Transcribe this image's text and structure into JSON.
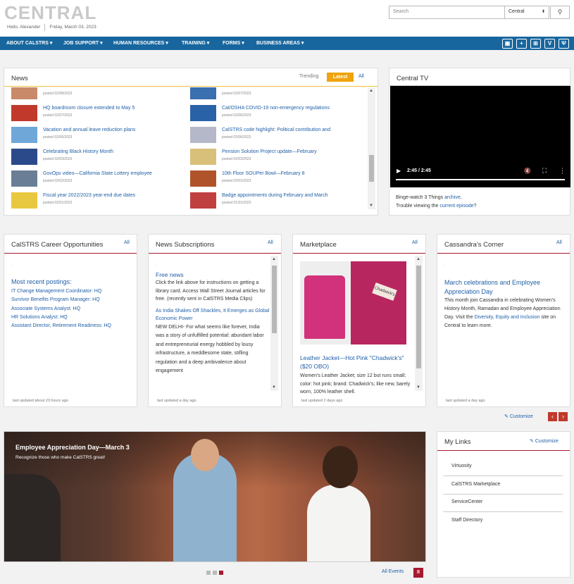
{
  "header": {
    "logo": "CENTRAL",
    "greeting": "Hello, Alexander",
    "date": "Friday, March 03, 2023",
    "search_placeholder": "Search",
    "scope": "Central",
    "search_icon": "search-icon"
  },
  "nav": {
    "items": [
      "ABOUT CALSTRS",
      "JOB SUPPORT",
      "HUMAN RESOURCES",
      "TRAINING",
      "FORMS",
      "BUSINESS AREAS"
    ],
    "icons": [
      "screen-icon",
      "plus-box-icon",
      "org-chart-icon",
      "v-icon",
      "utensils-icon"
    ]
  },
  "news": {
    "title": "News",
    "tabs": {
      "trending": "Trending",
      "latest": "Latest",
      "all": "All"
    },
    "left": [
      {
        "title": "",
        "date": "posted 02/08/2023",
        "color": "#c98a6a"
      },
      {
        "title": "HQ boardroom closure extended to May 5",
        "date": "posted 02/07/2023",
        "color": "#c0392b"
      },
      {
        "title": "Vacation and annual leave reduction plans",
        "date": "posted 02/06/2023",
        "color": "#6fa8d8"
      },
      {
        "title": "Celebrating Black History Month",
        "date": "posted 02/03/2023",
        "color": "#2b4a8a"
      },
      {
        "title": "GovOps video—California State Lottery employee",
        "date": "posted 02/02/2023",
        "color": "#6a7f95"
      },
      {
        "title": "Fiscal year 2022/2023 year-end due dates",
        "date": "posted 02/01/2023",
        "color": "#e8c840"
      }
    ],
    "right": [
      {
        "title": "",
        "date": "posted 02/07/2023",
        "color": "#3a6fb0"
      },
      {
        "title": "Cal/OSHA COVID-19 non-emergency regulations",
        "date": "posted 02/06/2023",
        "color": "#2a62a8"
      },
      {
        "title": "CalSTRS code highlight: Political contribution and",
        "date": "posted 02/06/2023",
        "color": "#b5b8c8"
      },
      {
        "title": "Pension Solution Project update—February",
        "date": "posted 02/03/2023",
        "color": "#d8c07a"
      },
      {
        "title": "10th Floor SOUPer Bowl—February 8",
        "date": "posted 02/01/2023",
        "color": "#b0532a"
      },
      {
        "title": "Badge appointments during February and March",
        "date": "posted 01/31/2023",
        "color": "#c04040"
      }
    ]
  },
  "tv": {
    "title": "Central TV",
    "time": "2:45 / 2:45",
    "line1": "Binge-watch 3 Things ",
    "archive": "archive",
    "line1_end": ".",
    "line2": "Trouble viewing the ",
    "current": "current episode",
    "line2_end": "?"
  },
  "career": {
    "title": "CalSTRS Career Opportunities",
    "all": "All",
    "heading": "Most recent postings:",
    "items": [
      "IT Change Management Coordinator: HQ",
      "Survivor Benefits Program Manager: HQ",
      "Associate Systems Analyst: HQ",
      "HR Solutions Analyst: HQ",
      "Assistant Director, Retirement Readiness: HQ"
    ],
    "updated": "last updated about 23 hours ago"
  },
  "subs": {
    "title": "News Subscriptions",
    "all": "All",
    "heading": "Free news",
    "body": "Click the link above for instructions on getting a library card. Access Wall Street Journal articles for free. (recently sent in CalSTRS Media Clips)",
    "link2": "As India Shakes Off Shackles, It Emerges as Global Economic Power",
    "body2": "NEW DELHI- For what seems like forever, India was a story of unfulfilled potential: abundant labor and entrepreneurial energy hobbled by lousy infrastructure, a meddlesome state, stifling regulation and a deep ambivalence about engagement",
    "updated": "last updated a day ago"
  },
  "market": {
    "title": "Marketplace",
    "all": "All",
    "heading": "Leather Jacket—Hot Pink \"Chadwick's\"($20 OBO)",
    "body": "Women's Leather Jacket; size 12 but runs small; color: hot pink; brand: Chadwick's; like new, barely worn, 100% leather shell.",
    "updated": "last updated 2 days ago"
  },
  "cass": {
    "title": "Cassandra's Corner",
    "all": "All",
    "heading": "March celebrations and Employee Appreciation Day",
    "body1": "This month join Cassandra in celebrating Women's History Month, Ramadan and Employee Appreciation Day. Visit the ",
    "link": "Diversity, Equity and Inclusion",
    "body2": " site on Central to learn more.",
    "updated": "last updated a day ago"
  },
  "customize": "Customize",
  "banner": {
    "title": "Employee Appreciation Day—March 3",
    "subtitle": "Recognize those who make CalSTRS great!",
    "all_events": "All Events"
  },
  "mylinks": {
    "title": "My Links",
    "customize": "Customize",
    "items": [
      "Virtuosity",
      "CalSTRS Marketplace",
      "ServiceCenter",
      "Staff Directory"
    ]
  },
  "colors": {
    "nav": "#17669e",
    "accent": "#a6192e",
    "latest": "#f0a30a",
    "link": "#1f5fa8"
  }
}
